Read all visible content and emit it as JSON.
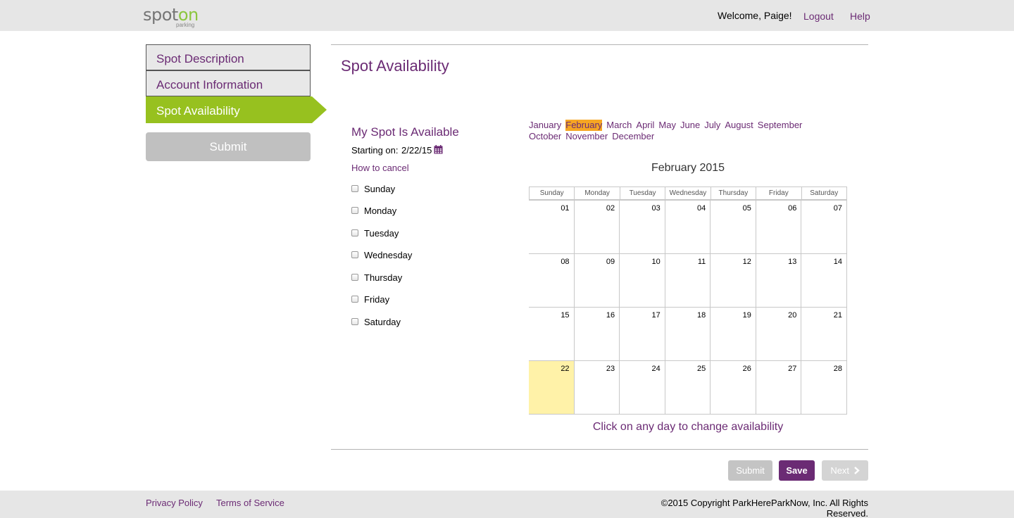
{
  "header": {
    "logo_main_a": "spot",
    "logo_main_b": "on",
    "logo_sub": "parking",
    "welcome": "Welcome, Paige!",
    "logout": "Logout",
    "help": "Help"
  },
  "sidebar": {
    "items": [
      {
        "label": "Spot Description"
      },
      {
        "label": "Account Information"
      },
      {
        "label": "Spot Availability"
      }
    ],
    "submit": "Submit"
  },
  "main": {
    "title": "Spot Availability",
    "availability": {
      "heading": "My Spot Is Available",
      "starting_label": "Starting on:",
      "starting_value": "2/22/15",
      "how_cancel": "How to cancel",
      "days": [
        "Sunday",
        "Monday",
        "Tuesday",
        "Wednesday",
        "Thursday",
        "Friday",
        "Saturday"
      ]
    },
    "months": [
      "January",
      "February",
      "March",
      "April",
      "May",
      "June",
      "July",
      "August",
      "September",
      "October",
      "November",
      "December"
    ],
    "selected_month": "February",
    "calendar": {
      "title": "February 2015",
      "weekdays": [
        "Sunday",
        "Monday",
        "Tuesday",
        "Wednesday",
        "Thursday",
        "Friday",
        "Saturday"
      ],
      "days": [
        "01",
        "02",
        "03",
        "04",
        "05",
        "06",
        "07",
        "08",
        "09",
        "10",
        "11",
        "12",
        "13",
        "14",
        "15",
        "16",
        "17",
        "18",
        "19",
        "20",
        "21",
        "22",
        "23",
        "24",
        "25",
        "26",
        "27",
        "28"
      ],
      "highlighted_day": "22",
      "note": "Click on any day to change availability"
    },
    "buttons": {
      "submit": "Submit",
      "save": "Save",
      "next": "Next"
    }
  },
  "footer": {
    "privacy": "Privacy Policy",
    "terms": "Terms of Service",
    "copyright": "©2015 Copyright ParkHereParkNow, Inc. All Rights Reserved."
  },
  "colors": {
    "brand_purple": "#6b2b74",
    "active_green": "#97c11f",
    "month_highlight": "#f6a623",
    "today_highlight": "#fff2a8"
  }
}
